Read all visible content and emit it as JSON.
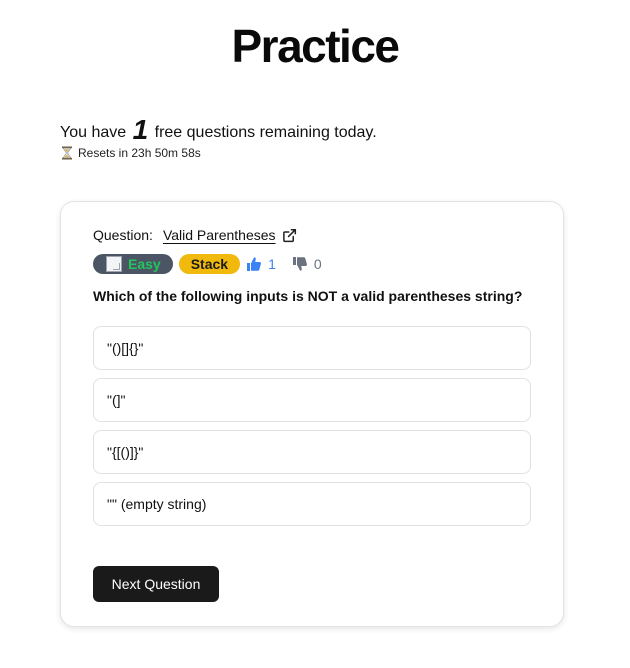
{
  "header": {
    "title": "Practice"
  },
  "quota": {
    "prefix": "You have",
    "count": "1",
    "suffix": "free questions remaining today.",
    "reset_text": "Resets in 23h 50m 58s",
    "reset_icon": "hourglass-icon"
  },
  "question": {
    "label": "Question:",
    "link_text": "Valid Parentheses",
    "link_icon": "external-link-icon",
    "difficulty": "Easy",
    "difficulty_color": "#22c55e",
    "topic": "Stack",
    "topic_color": "#f0b90b",
    "upvotes": "1",
    "downvotes": "0",
    "prompt": "Which of the following inputs is NOT a valid parentheses string?",
    "options": [
      "\"()[]{}\"",
      "\"(]\"",
      "\"{[()]}\"",
      "\"\" (empty string)"
    ]
  },
  "actions": {
    "next_label": "Next Question",
    "accent_color": "#1a1a1a"
  }
}
